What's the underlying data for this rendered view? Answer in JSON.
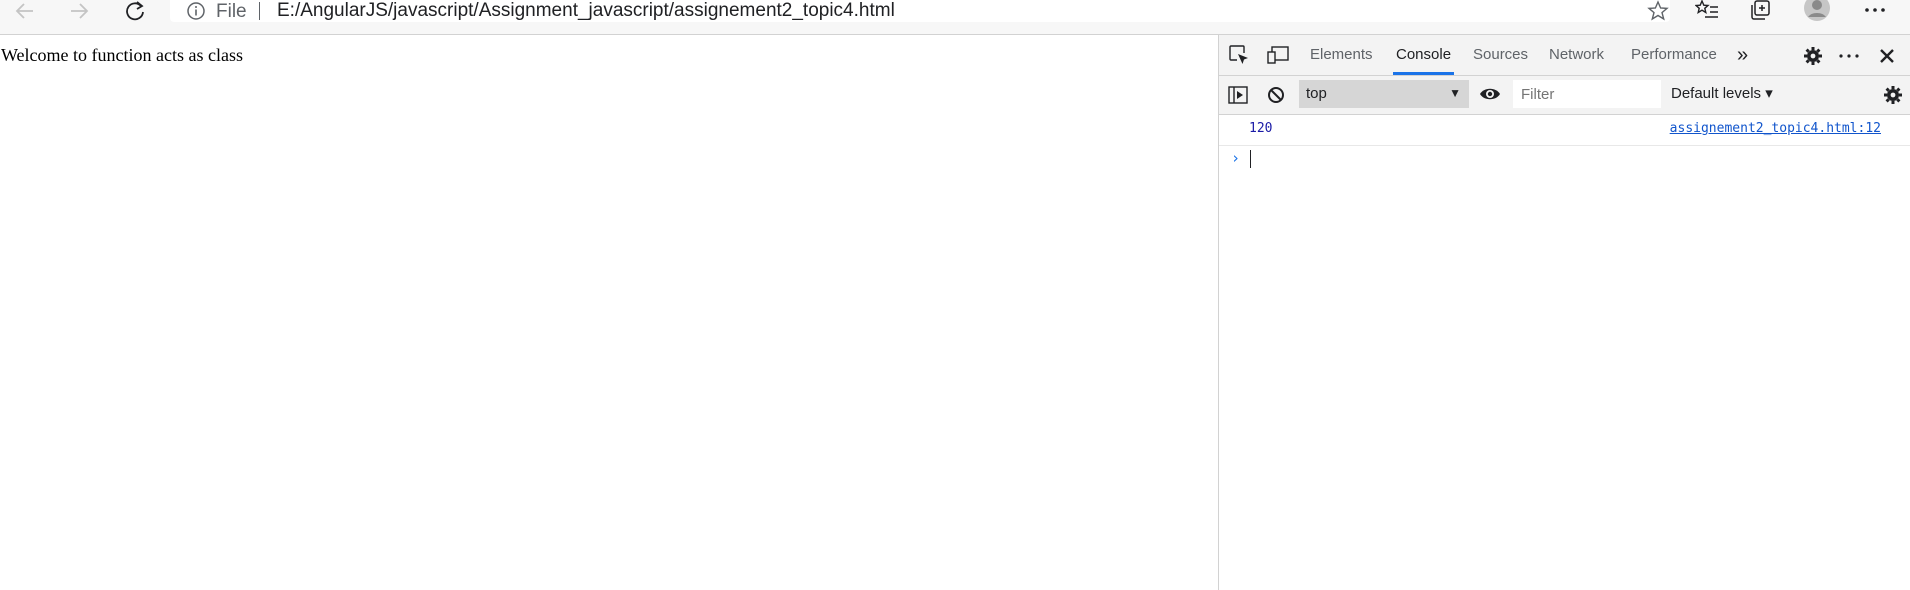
{
  "browser": {
    "address": {
      "info_icon": "info-icon",
      "scheme_label": "File",
      "url": "E:/AngularJS/javascript/Assignment_javascript/assignement2_topic4.html"
    }
  },
  "page": {
    "text": "Welcome to function acts as class"
  },
  "devtools": {
    "tabs": [
      {
        "label": "Elements"
      },
      {
        "label": "Console",
        "active": true
      },
      {
        "label": "Sources"
      },
      {
        "label": "Network"
      },
      {
        "label": "Performance"
      }
    ],
    "more_tabs": "»",
    "console": {
      "context": "top",
      "filter_placeholder": "Filter",
      "levels_label": "Default levels ▾",
      "logs": [
        {
          "value": "120",
          "source": "assignement2_topic4.html:12"
        }
      ],
      "prompt": "›"
    },
    "colors": {
      "accent": "#1a73e8",
      "log_number": "#1a1aa6",
      "link": "#1155cc"
    }
  }
}
